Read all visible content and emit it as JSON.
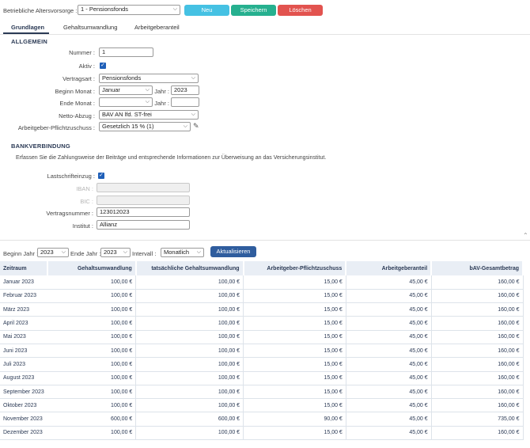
{
  "top": {
    "pension_label": "Betriebliche Altersvorsorge :",
    "pension_value": "1 - Pensionsfonds",
    "new_button": "Neu",
    "save_button": "Speichern",
    "delete_button": "Löschen",
    "colors": {
      "new": "#45c1e3",
      "save": "#26b08f",
      "delete": "#e2534f"
    }
  },
  "tabs": [
    "Grundlagen",
    "Gehaltsumwandlung",
    "Arbeitgeberanteil"
  ],
  "general": {
    "title": "ALLGEMEIN",
    "number_label": "Nummer :",
    "number_value": "1",
    "active_label": "Aktiv :",
    "contract_type_label": "Vertragsart :",
    "contract_type_value": "Pensionsfonds",
    "start_month_label": "Beginn Monat :",
    "start_month_value": "Januar",
    "start_year_label": "Jahr :",
    "start_year_value": "2023",
    "end_month_label": "Ende Monat :",
    "end_month_value": "",
    "end_year_label": "Jahr :",
    "end_year_value": "",
    "net_deduction_label": "Netto-Abzug :",
    "net_deduction_value": "BAV AN lfd. ST-frei",
    "employer_subsidy_label": "Arbeitgeber-Pflichtzuschuss :",
    "employer_subsidy_value": "Gesetzlich 15 % (1)"
  },
  "bank": {
    "title": "BANKVERBINDUNG",
    "description": "Erfassen Sie die Zahlungsweise der Beiträge und entsprechende Informationen zur Überweisung an das Versicherungsinstitut.",
    "direct_debit_label": "Lastschrifteinzug :",
    "iban_label": "IBAN :",
    "iban_value": "",
    "bic_label": "BIC :",
    "bic_value": "",
    "contract_number_label": "Vertragsnummer :",
    "contract_number_value": "123012023",
    "institute_label": "Institut :",
    "institute_value": "Allianz"
  },
  "filter": {
    "start_year_label": "Beginn Jahr :",
    "start_year_value": "2023",
    "end_year_label": "Ende Jahr :",
    "end_year_value": "2023",
    "interval_label": "Intervall :",
    "interval_value": "Monatlich",
    "refresh_button": "Aktualisieren",
    "refresh_color": "#2f5d9e"
  },
  "table": {
    "headers": [
      "Zeitraum",
      "Gehaltsumwandlung",
      "tatsächliche Gehaltsumwandlung",
      "Arbeitgeber-Pflichtzuschuss",
      "Arbeitgeberanteil",
      "bAV-Gesamtbetrag"
    ],
    "rows": [
      [
        "Januar 2023",
        "100,00 €",
        "100,00 €",
        "15,00 €",
        "45,00 €",
        "160,00 €"
      ],
      [
        "Februar 2023",
        "100,00 €",
        "100,00 €",
        "15,00 €",
        "45,00 €",
        "160,00 €"
      ],
      [
        "März 2023",
        "100,00 €",
        "100,00 €",
        "15,00 €",
        "45,00 €",
        "160,00 €"
      ],
      [
        "April 2023",
        "100,00 €",
        "100,00 €",
        "15,00 €",
        "45,00 €",
        "160,00 €"
      ],
      [
        "Mai 2023",
        "100,00 €",
        "100,00 €",
        "15,00 €",
        "45,00 €",
        "160,00 €"
      ],
      [
        "Juni 2023",
        "100,00 €",
        "100,00 €",
        "15,00 €",
        "45,00 €",
        "160,00 €"
      ],
      [
        "Juli 2023",
        "100,00 €",
        "100,00 €",
        "15,00 €",
        "45,00 €",
        "160,00 €"
      ],
      [
        "August 2023",
        "100,00 €",
        "100,00 €",
        "15,00 €",
        "45,00 €",
        "160,00 €"
      ],
      [
        "September 2023",
        "100,00 €",
        "100,00 €",
        "15,00 €",
        "45,00 €",
        "160,00 €"
      ],
      [
        "Oktober 2023",
        "100,00 €",
        "100,00 €",
        "15,00 €",
        "45,00 €",
        "160,00 €"
      ],
      [
        "November 2023",
        "600,00 €",
        "600,00 €",
        "90,00 €",
        "45,00 €",
        "735,00 €"
      ],
      [
        "Dezember 2023",
        "100,00 €",
        "100,00 €",
        "15,00 €",
        "45,00 €",
        "160,00 €"
      ]
    ]
  }
}
